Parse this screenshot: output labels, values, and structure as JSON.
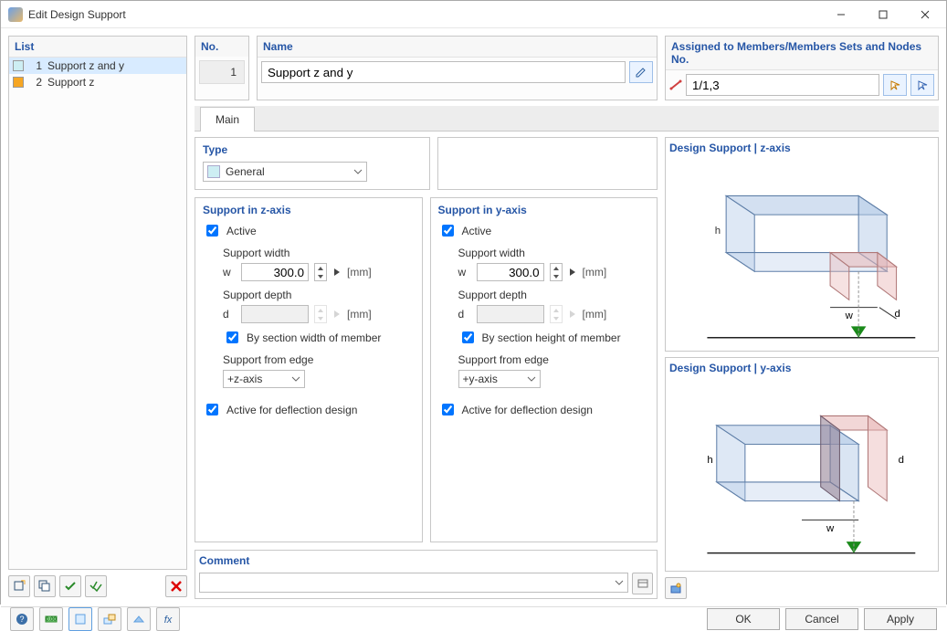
{
  "window": {
    "title": "Edit Design Support"
  },
  "list": {
    "header": "List",
    "items": [
      {
        "num": "1",
        "label": "Support z and y",
        "color": "#cdeef3",
        "selected": true
      },
      {
        "num": "2",
        "label": "Support z",
        "color": "#f6a623",
        "selected": false
      }
    ]
  },
  "no": {
    "header": "No.",
    "value": "1"
  },
  "name": {
    "header": "Name",
    "value": "Support z and y"
  },
  "assigned": {
    "header": "Assigned to Members/Members Sets and Nodes No.",
    "value": "1/1,3"
  },
  "tabs": {
    "main": "Main"
  },
  "type": {
    "header": "Type",
    "value": "General"
  },
  "z": {
    "header": "Support in z-axis",
    "active_label": "Active",
    "width_label": "Support width",
    "width_sym": "w",
    "width_value": "300.0",
    "width_unit": "[mm]",
    "depth_label": "Support depth",
    "depth_sym": "d",
    "depth_value": "",
    "depth_unit": "[mm]",
    "by_section_label": "By section width of member",
    "edge_header": "Support from edge",
    "edge_value": "+z-axis",
    "deflection_label": "Active for deflection design"
  },
  "y": {
    "header": "Support in y-axis",
    "active_label": "Active",
    "width_label": "Support width",
    "width_sym": "w",
    "width_value": "300.0",
    "width_unit": "[mm]",
    "depth_label": "Support depth",
    "depth_sym": "d",
    "depth_value": "",
    "depth_unit": "[mm]",
    "by_section_label": "By section height of member",
    "edge_header": "Support from edge",
    "edge_value": "+y-axis",
    "deflection_label": "Active for deflection design"
  },
  "preview": {
    "z_title": "Design Support | z-axis",
    "y_title": "Design Support | y-axis"
  },
  "comment": {
    "header": "Comment",
    "value": ""
  },
  "buttons": {
    "ok": "OK",
    "cancel": "Cancel",
    "apply": "Apply"
  }
}
